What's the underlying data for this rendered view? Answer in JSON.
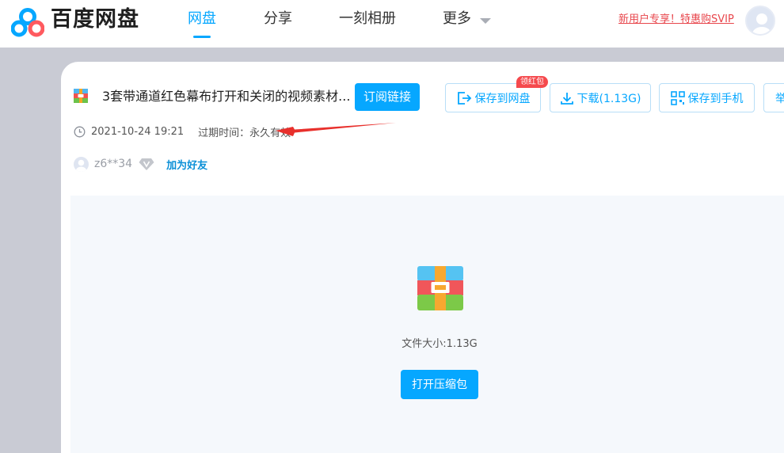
{
  "header": {
    "logo_text": "百度网盘",
    "nav": [
      {
        "label": "网盘",
        "active": true
      },
      {
        "label": "分享",
        "active": false
      },
      {
        "label": "一刻相册",
        "active": false
      },
      {
        "label": "更多",
        "active": false
      }
    ],
    "promo_text": "新用户专享！特惠购SVIP",
    "accent_color": "#06a7ff"
  },
  "file": {
    "title": "3套带通道红色幕布打开和关闭的视频素材...",
    "subscribe_label": "订阅链接",
    "save_label": "保存到网盘",
    "save_badge": "领红包",
    "download_label": "下载(1.13G)",
    "save_phone_label": "保存到手机",
    "report_label_partial": "举",
    "date": "2021-10-24 19:21",
    "expire_label": "过期时间：",
    "expire_value": "永久有效"
  },
  "user": {
    "name": "z6**34",
    "add_friend_label": "加为好友"
  },
  "preview": {
    "size_text": "文件大小:1.13G",
    "open_label": "打开压缩包"
  },
  "icons": [
    "baidu-netdisk-logo",
    "chevron-down-icon",
    "avatar",
    "zip-file-icon",
    "save-icon",
    "download-icon",
    "qr-phone-icon",
    "clock-icon",
    "vip-diamond-icon",
    "red-arrow-annotation"
  ]
}
